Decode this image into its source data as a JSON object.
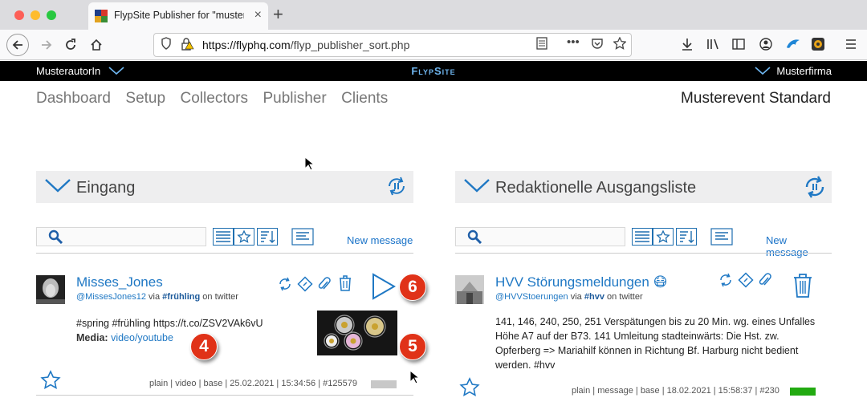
{
  "browser": {
    "tab_title": "FlypSite Publisher for \"musterfi",
    "url_host": "https://flyphq.com",
    "url_path": "/flyp_publisher_sort.php"
  },
  "topbar": {
    "user": "MusterautorIn",
    "brand": "FlypSite",
    "company": "Musterfirma"
  },
  "nav": {
    "items": [
      "Dashboard",
      "Setup",
      "Collectors",
      "Publisher",
      "Clients"
    ],
    "event": "Musterevent Standard"
  },
  "inbox": {
    "title": "Eingang",
    "new_message": "New message",
    "card": {
      "author": "Misses_Jones",
      "handle": "@MissesJones12",
      "via": "via",
      "tag": "#frühling",
      "source": "on twitter",
      "text": "#spring #frühling https://t.co/ZSV2VAk6vU",
      "media_label": "Media:",
      "media_link": "video/youtube",
      "meta": "plain | video | base | 25.02.2021 | 15:34:56 | #125579",
      "status_color": "#c8c8c8"
    }
  },
  "outbox": {
    "title": "Redaktionelle Ausgangsliste",
    "new_message": "New message",
    "card": {
      "author": "HVV Störungsmeldungen 😷",
      "handle": "@HVVStoerungen",
      "via": "via",
      "tag": "#hvv",
      "source": "on twitter",
      "text": "141, 146, 240, 250, 251 Verspätungen bis zu 20 Min. wg. eines Unfalles Höhe A7 auf der B73. 141 Umleitung stadteinwärts: Die Hst. zw. Opferberg => Mariahilf können in Richtung Bf. Harburg nicht bedient werden. #hvv",
      "meta": "plain | message | base | 18.02.2021 | 15:58:37 | #230",
      "status_color": "#22aa11"
    }
  },
  "annotations": [
    "4",
    "5",
    "6"
  ],
  "colors": {
    "accent": "#1f78c4",
    "badge": "#e03218"
  }
}
